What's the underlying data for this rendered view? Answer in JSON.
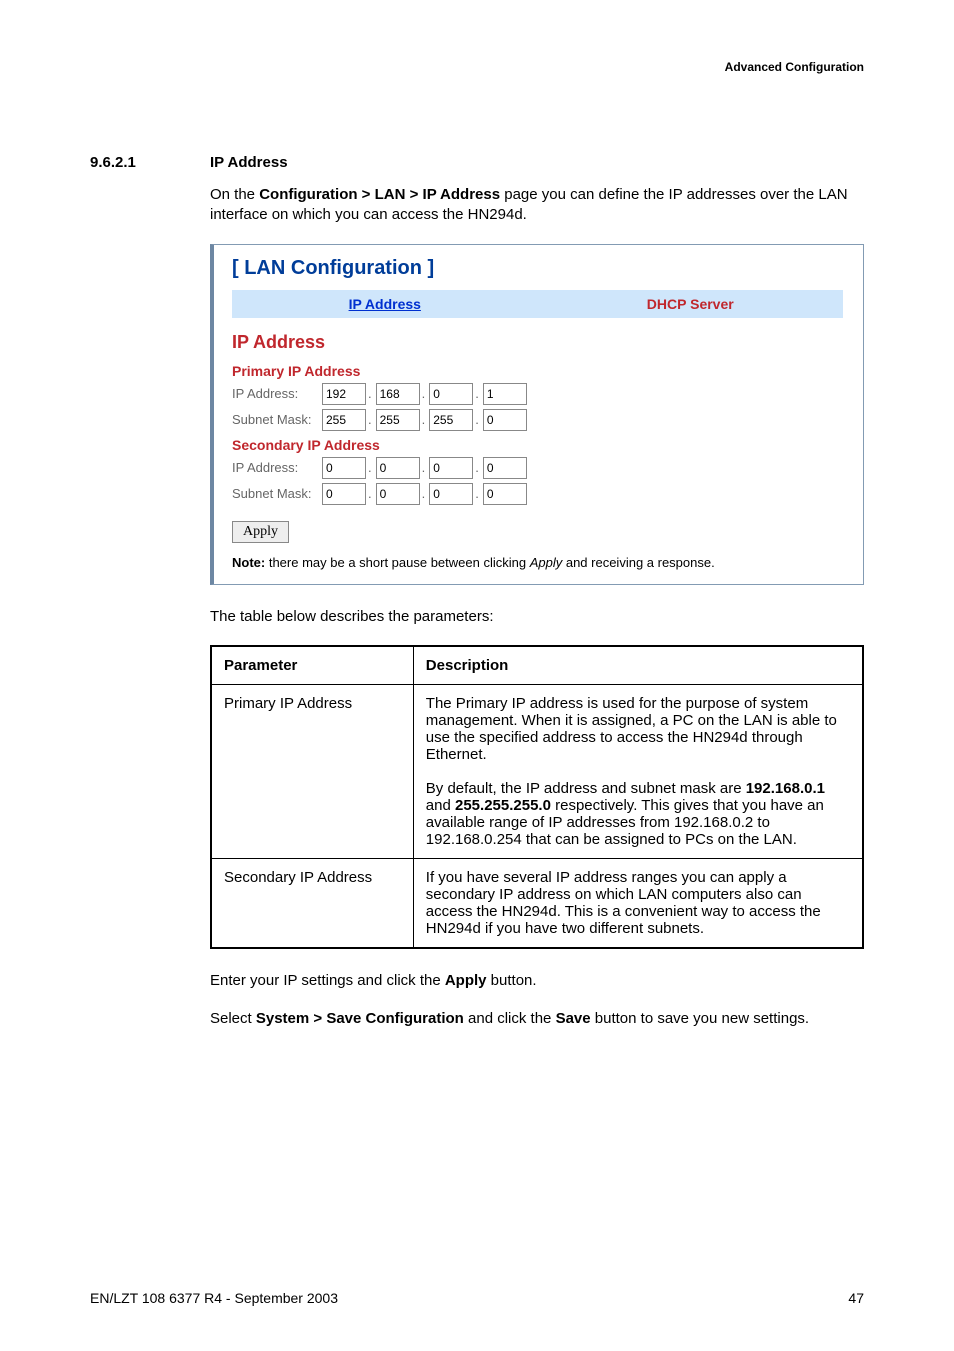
{
  "header": {
    "running": "Advanced Configuration"
  },
  "section": {
    "number": "9.6.2.1",
    "title": "IP Address"
  },
  "intro": {
    "pre": "On the ",
    "path": "Configuration > LAN > IP Address",
    "post": " page you can define the IP addresses over the LAN interface on which you can access the HN294d."
  },
  "app": {
    "title": "[ LAN Configuration ]",
    "tabs": {
      "ip": "IP Address",
      "dhcp": "DHCP Server"
    },
    "heading": "IP Address",
    "primary": {
      "title": "Primary IP Address",
      "ip_label": "IP Address:",
      "mask_label": "Subnet Mask:",
      "ip": [
        "192",
        "168",
        "0",
        "1"
      ],
      "mask": [
        "255",
        "255",
        "255",
        "0"
      ]
    },
    "secondary": {
      "title": "Secondary IP Address",
      "ip_label": "IP Address:",
      "mask_label": "Subnet Mask:",
      "ip": [
        "0",
        "0",
        "0",
        "0"
      ],
      "mask": [
        "0",
        "0",
        "0",
        "0"
      ]
    },
    "apply": "Apply",
    "note_prefix": "Note:",
    "note_text": " there may be a short pause between clicking ",
    "note_apply_word": "Apply",
    "note_tail": " and receiving a response."
  },
  "afterScreenshot": "The table below describes the parameters:",
  "table": {
    "head_param": "Parameter",
    "head_desc": "Description",
    "rows": [
      {
        "param": "Primary IP Address",
        "desc1": "The Primary IP address is used for the purpose of system management. When it is assigned, a PC on the LAN is able to use the specified address to access the HN294d through Ethernet.",
        "desc2_pre": "By default, the IP address and subnet mask are ",
        "desc2_bold1": "192.168.0.1",
        "desc2_mid": " and ",
        "desc2_bold2": "255.255.255.0",
        "desc2_post": " respectively. This gives that you have an available range of IP addresses from 192.168.0.2 to 192.168.0.254 that can be assigned to PCs on the LAN."
      },
      {
        "param": "Secondary IP Address",
        "desc1": "If you have several IP address ranges you can apply a secondary IP address on which LAN computers also can access the HN294d. This is a convenient way to access the HN294d if you have two different subnets."
      }
    ]
  },
  "after_table1": {
    "pre": "Enter your IP settings and click the ",
    "bold": "Apply",
    "post": " button."
  },
  "after_table2": {
    "pre": "Select ",
    "bold1": "System > Save Configuration",
    "mid": " and click the ",
    "bold2": "Save",
    "post": " button to save you new settings."
  },
  "footer": {
    "left": "EN/LZT 108 6377 R4 - September 2003",
    "right": "47"
  }
}
